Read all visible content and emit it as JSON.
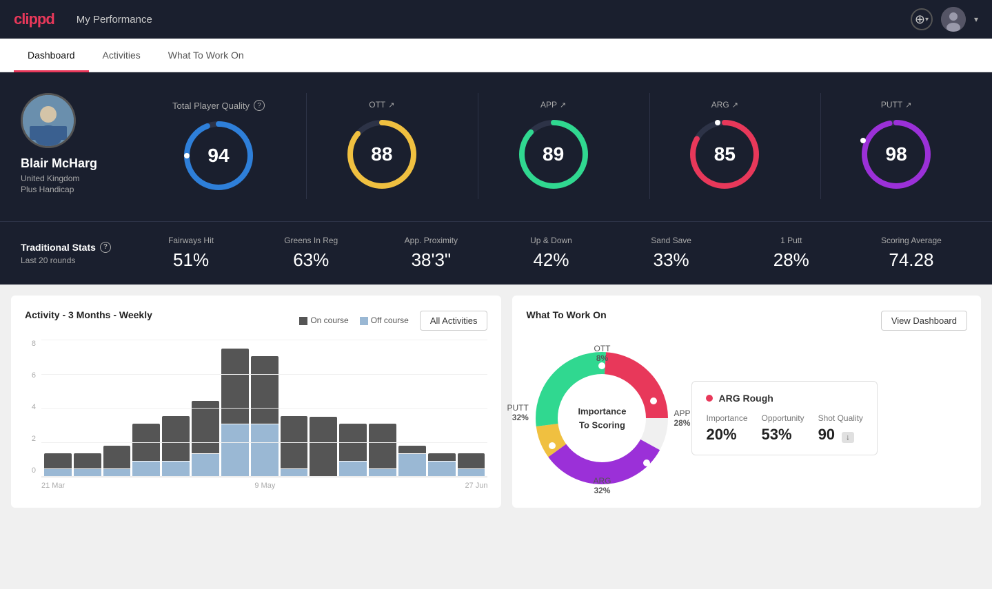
{
  "app": {
    "logo": "clippd",
    "nav_title": "My Performance",
    "add_icon": "+",
    "avatar_text": "👤",
    "dropdown": "▾"
  },
  "tabs": [
    {
      "id": "dashboard",
      "label": "Dashboard",
      "active": true
    },
    {
      "id": "activities",
      "label": "Activities",
      "active": false
    },
    {
      "id": "whattoworkon",
      "label": "What To Work On",
      "active": false
    }
  ],
  "player": {
    "name": "Blair McHarg",
    "country": "United Kingdom",
    "handicap": "Plus Handicap"
  },
  "scores": {
    "tpq": {
      "label": "Total Player Quality",
      "value": "94",
      "color": "#2e7fd9"
    },
    "ott": {
      "label": "OTT",
      "value": "88",
      "color": "#f0c040",
      "arrow": "↗"
    },
    "app": {
      "label": "APP",
      "value": "89",
      "color": "#30d890",
      "arrow": "↗"
    },
    "arg": {
      "label": "ARG",
      "value": "85",
      "color": "#e8385a",
      "arrow": "↗"
    },
    "putt": {
      "label": "PUTT",
      "value": "98",
      "color": "#9b30d8",
      "arrow": "↗"
    }
  },
  "trad_stats": {
    "title": "Traditional Stats",
    "period": "Last 20 rounds",
    "items": [
      {
        "name": "Fairways Hit",
        "value": "51%"
      },
      {
        "name": "Greens In Reg",
        "value": "63%"
      },
      {
        "name": "App. Proximity",
        "value": "38'3\""
      },
      {
        "name": "Up & Down",
        "value": "42%"
      },
      {
        "name": "Sand Save",
        "value": "33%"
      },
      {
        "name": "1 Putt",
        "value": "28%"
      },
      {
        "name": "Scoring Average",
        "value": "74.28"
      }
    ]
  },
  "activity_chart": {
    "title": "Activity - 3 Months - Weekly",
    "legend_oncourse": "On course",
    "legend_offcourse": "Off course",
    "all_activities_btn": "All Activities",
    "y_labels": [
      "8",
      "6",
      "4",
      "2",
      "0"
    ],
    "x_labels": [
      "21 Mar",
      "9 May",
      "27 Jun"
    ],
    "bars": [
      {
        "on": 1,
        "off": 0.5
      },
      {
        "on": 1,
        "off": 0.5
      },
      {
        "on": 1.5,
        "off": 0.5
      },
      {
        "on": 2.5,
        "off": 1
      },
      {
        "on": 3,
        "off": 1
      },
      {
        "on": 3.5,
        "off": 1.5
      },
      {
        "on": 5,
        "off": 3.5
      },
      {
        "on": 4.5,
        "off": 3.5
      },
      {
        "on": 3.5,
        "off": 0.5
      },
      {
        "on": 4,
        "off": 0
      },
      {
        "on": 2.5,
        "off": 1
      },
      {
        "on": 3,
        "off": 0.5
      },
      {
        "on": 0.5,
        "off": 1.5
      },
      {
        "on": 0.5,
        "off": 1
      },
      {
        "on": 1,
        "off": 0.5
      }
    ]
  },
  "what_to_work_on": {
    "title": "What To Work On",
    "view_dashboard_btn": "View Dashboard",
    "donut_center_line1": "Importance",
    "donut_center_line2": "To Scoring",
    "segments": [
      {
        "label": "OTT",
        "percent": "8%",
        "color": "#f0c040"
      },
      {
        "label": "APP",
        "percent": "28%",
        "color": "#30d890"
      },
      {
        "label": "ARG",
        "percent": "32%",
        "color": "#e8385a"
      },
      {
        "label": "PUTT",
        "percent": "32%",
        "color": "#9b30d8"
      }
    ],
    "arg_card": {
      "title": "ARG Rough",
      "dot_color": "#e8385a",
      "metrics": [
        {
          "label": "Importance",
          "value": "20%"
        },
        {
          "label": "Opportunity",
          "value": "53%"
        },
        {
          "label": "Shot Quality",
          "value": "90",
          "badge": "↓"
        }
      ]
    }
  }
}
